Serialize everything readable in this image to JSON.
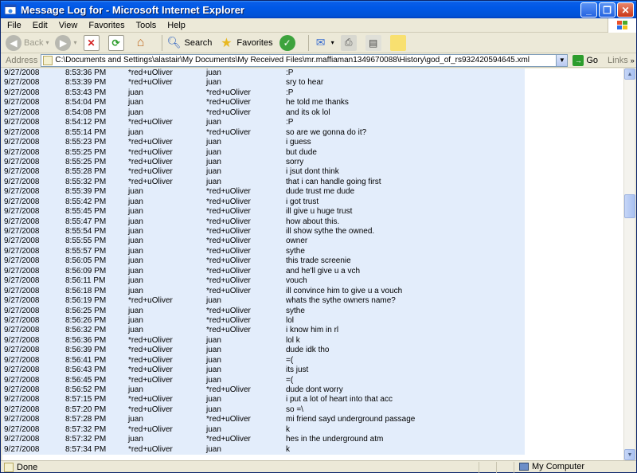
{
  "window": {
    "title": "Message Log for - Microsoft Internet Explorer"
  },
  "menu": [
    "File",
    "Edit",
    "View",
    "Favorites",
    "Tools",
    "Help"
  ],
  "toolbar": {
    "back_label": "Back",
    "search_label": "Search",
    "favorites_label": "Favorites"
  },
  "address": {
    "label": "Address",
    "value": "C:\\Documents and Settings\\alastair\\My Documents\\My Received Files\\mr.maffiaman1349670088\\History\\god_of_rs932420594645.xml",
    "go_label": "Go",
    "links_label": "Links"
  },
  "log": [
    {
      "date": "9/27/2008",
      "time": "8:53:36 PM",
      "from": "*red+uOliver",
      "to": "juan",
      "msg": ":P"
    },
    {
      "date": "9/27/2008",
      "time": "8:53:39 PM",
      "from": "*red+uOliver",
      "to": "juan",
      "msg": "sry to hear"
    },
    {
      "date": "9/27/2008",
      "time": "8:53:43 PM",
      "from": "juan",
      "to": "*red+uOliver",
      "msg": ":P"
    },
    {
      "date": "9/27/2008",
      "time": "8:54:04 PM",
      "from": "juan",
      "to": "*red+uOliver",
      "msg": "he told me thanks"
    },
    {
      "date": "9/27/2008",
      "time": "8:54:08 PM",
      "from": "juan",
      "to": "*red+uOliver",
      "msg": "and its ok lol"
    },
    {
      "date": "9/27/2008",
      "time": "8:54:12 PM",
      "from": "*red+uOliver",
      "to": "juan",
      "msg": ":P"
    },
    {
      "date": "9/27/2008",
      "time": "8:55:14 PM",
      "from": "juan",
      "to": "*red+uOliver",
      "msg": "so are we gonna do it?"
    },
    {
      "date": "9/27/2008",
      "time": "8:55:23 PM",
      "from": "*red+uOliver",
      "to": "juan",
      "msg": "i guess"
    },
    {
      "date": "9/27/2008",
      "time": "8:55:25 PM",
      "from": "*red+uOliver",
      "to": "juan",
      "msg": "but dude"
    },
    {
      "date": "9/27/2008",
      "time": "8:55:25 PM",
      "from": "*red+uOliver",
      "to": "juan",
      "msg": "sorry"
    },
    {
      "date": "9/27/2008",
      "time": "8:55:28 PM",
      "from": "*red+uOliver",
      "to": "juan",
      "msg": "i jsut dont think"
    },
    {
      "date": "9/27/2008",
      "time": "8:55:32 PM",
      "from": "*red+uOliver",
      "to": "juan",
      "msg": "that i can handle going first"
    },
    {
      "date": "9/27/2008",
      "time": "8:55:39 PM",
      "from": "juan",
      "to": "*red+uOliver",
      "msg": "dude trust me dude"
    },
    {
      "date": "9/27/2008",
      "time": "8:55:42 PM",
      "from": "juan",
      "to": "*red+uOliver",
      "msg": "i got trust"
    },
    {
      "date": "9/27/2008",
      "time": "8:55:45 PM",
      "from": "juan",
      "to": "*red+uOliver",
      "msg": "ill give u huge trust"
    },
    {
      "date": "9/27/2008",
      "time": "8:55:47 PM",
      "from": "juan",
      "to": "*red+uOliver",
      "msg": "how about this."
    },
    {
      "date": "9/27/2008",
      "time": "8:55:54 PM",
      "from": "juan",
      "to": "*red+uOliver",
      "msg": "ill show sythe the owned."
    },
    {
      "date": "9/27/2008",
      "time": "8:55:55 PM",
      "from": "juan",
      "to": "*red+uOliver",
      "msg": "owner"
    },
    {
      "date": "9/27/2008",
      "time": "8:55:57 PM",
      "from": "juan",
      "to": "*red+uOliver",
      "msg": "sythe"
    },
    {
      "date": "9/27/2008",
      "time": "8:56:05 PM",
      "from": "juan",
      "to": "*red+uOliver",
      "msg": "this trade screenie"
    },
    {
      "date": "9/27/2008",
      "time": "8:56:09 PM",
      "from": "juan",
      "to": "*red+uOliver",
      "msg": "and he'll give u a vch"
    },
    {
      "date": "9/27/2008",
      "time": "8:56:11 PM",
      "from": "juan",
      "to": "*red+uOliver",
      "msg": "vouch"
    },
    {
      "date": "9/27/2008",
      "time": "8:56:18 PM",
      "from": "juan",
      "to": "*red+uOliver",
      "msg": "ill convince him to give u a vouch"
    },
    {
      "date": "9/27/2008",
      "time": "8:56:19 PM",
      "from": "*red+uOliver",
      "to": "juan",
      "msg": "whats the sythe owners name?"
    },
    {
      "date": "9/27/2008",
      "time": "8:56:25 PM",
      "from": "juan",
      "to": "*red+uOliver",
      "msg": "sythe"
    },
    {
      "date": "9/27/2008",
      "time": "8:56:26 PM",
      "from": "juan",
      "to": "*red+uOliver",
      "msg": "lol"
    },
    {
      "date": "9/27/2008",
      "time": "8:56:32 PM",
      "from": "juan",
      "to": "*red+uOliver",
      "msg": "i know him in rl"
    },
    {
      "date": "9/27/2008",
      "time": "8:56:36 PM",
      "from": "*red+uOliver",
      "to": "juan",
      "msg": "lol k"
    },
    {
      "date": "9/27/2008",
      "time": "8:56:39 PM",
      "from": "*red+uOliver",
      "to": "juan",
      "msg": "dude idk tho"
    },
    {
      "date": "9/27/2008",
      "time": "8:56:41 PM",
      "from": "*red+uOliver",
      "to": "juan",
      "msg": "=("
    },
    {
      "date": "9/27/2008",
      "time": "8:56:43 PM",
      "from": "*red+uOliver",
      "to": "juan",
      "msg": "its just"
    },
    {
      "date": "9/27/2008",
      "time": "8:56:45 PM",
      "from": "*red+uOliver",
      "to": "juan",
      "msg": "=("
    },
    {
      "date": "9/27/2008",
      "time": "8:56:52 PM",
      "from": "juan",
      "to": "*red+uOliver",
      "msg": "dude dont worry"
    },
    {
      "date": "9/27/2008",
      "time": "8:57:15 PM",
      "from": "*red+uOliver",
      "to": "juan",
      "msg": "i put a lot of heart into that acc"
    },
    {
      "date": "9/27/2008",
      "time": "8:57:20 PM",
      "from": "*red+uOliver",
      "to": "juan",
      "msg": "so =\\"
    },
    {
      "date": "9/27/2008",
      "time": "8:57:28 PM",
      "from": "juan",
      "to": "*red+uOliver",
      "msg": "mi friend sayd underground passage"
    },
    {
      "date": "9/27/2008",
      "time": "8:57:32 PM",
      "from": "*red+uOliver",
      "to": "juan",
      "msg": "k"
    },
    {
      "date": "9/27/2008",
      "time": "8:57:32 PM",
      "from": "juan",
      "to": "*red+uOliver",
      "msg": "hes in the underground atm"
    },
    {
      "date": "9/27/2008",
      "time": "8:57:34 PM",
      "from": "*red+uOliver",
      "to": "juan",
      "msg": "k"
    }
  ],
  "status": {
    "text": "Done",
    "zone": "My Computer"
  }
}
